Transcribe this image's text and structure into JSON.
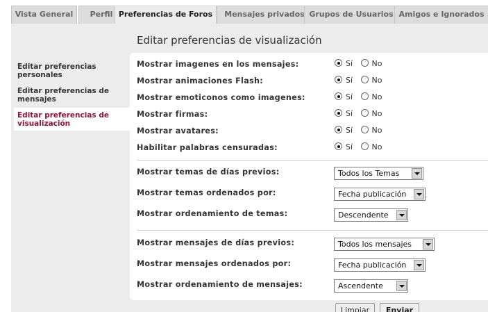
{
  "tabs": [
    {
      "label": "Vista General"
    },
    {
      "label": "Perfil"
    },
    {
      "label": "Preferencias de Foros"
    },
    {
      "label": "Mensajes privados"
    },
    {
      "label": "Grupos de Usuarios"
    },
    {
      "label": "Amigos e Ignorados"
    }
  ],
  "page_title": "Editar preferencias de visualización",
  "sidebar": {
    "items": [
      {
        "label": "Editar preferencias personales"
      },
      {
        "label": "Editar preferencias de mensajes"
      },
      {
        "label": "Editar preferencias de visualización"
      }
    ]
  },
  "radio_options": {
    "yes": "Sí",
    "no": "No"
  },
  "radio_rows": [
    {
      "label": "Mostrar imagenes en los mensajes:",
      "selected": "Sí"
    },
    {
      "label": "Mostrar animaciones Flash:",
      "selected": "Sí"
    },
    {
      "label": "Mostrar emoticonos como imagenes:",
      "selected": "Sí"
    },
    {
      "label": "Mostrar firmas:",
      "selected": "Sí"
    },
    {
      "label": "Mostrar avatares:",
      "selected": "Sí"
    },
    {
      "label": "Habilitar palabras censuradas:",
      "selected": "Sí"
    }
  ],
  "topic_rows": [
    {
      "label": "Mostrar temas de días previos:",
      "value": "Todos los Temas"
    },
    {
      "label": "Mostrar temas ordenados por:",
      "value": "Fecha publicación"
    },
    {
      "label": "Mostrar ordenamiento de temas:",
      "value": "Descendente"
    }
  ],
  "post_rows": [
    {
      "label": "Mostrar mensajes de días previos:",
      "value": "Todos los mensajes"
    },
    {
      "label": "Mostrar mensajes ordenados por:",
      "value": "Fecha publicación"
    },
    {
      "label": "Mostrar ordenamiento de mensajes:",
      "value": "Ascendente"
    }
  ],
  "buttons": {
    "reset": "Limpiar",
    "submit": "Enviar"
  }
}
